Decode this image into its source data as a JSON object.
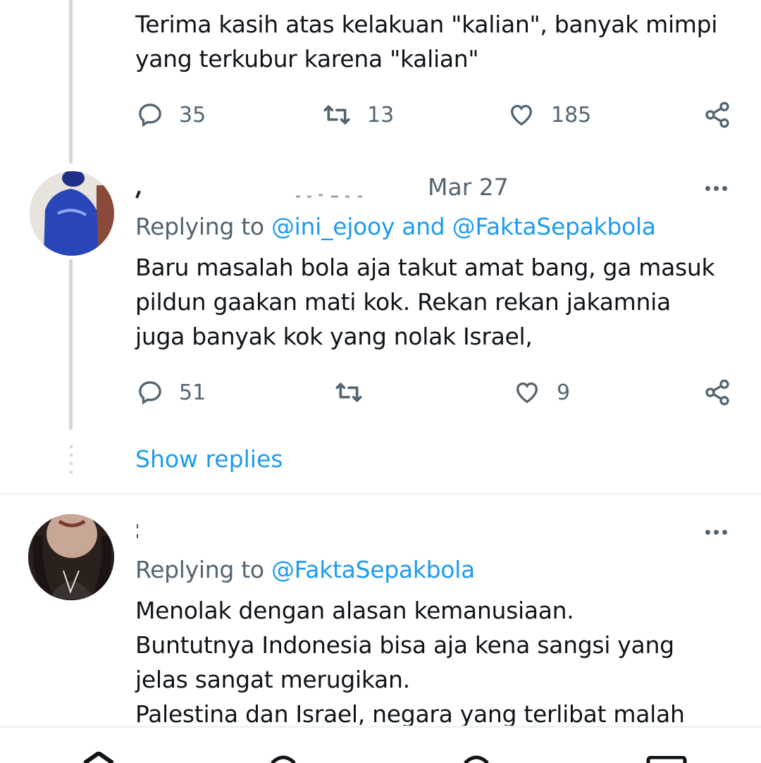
{
  "tweet_top": {
    "text_lines": [
      "Terima kasih atas kelakuan \"kalian\", banyak mimpi",
      "yang terkubur karena \"kalian\""
    ],
    "reply_count": "35",
    "retweet_count": "13",
    "like_count": "185"
  },
  "tweet_reply1": {
    "date": "Mar 27",
    "replying_prefix": "Replying to ",
    "mention1": "@ini_ejooy",
    "and": " and ",
    "mention2": "@FaktaSepakbola",
    "text_lines": [
      "Baru masalah bola aja takut amat bang, ga masuk",
      "pildun gaakan mati kok. Rekan rekan jakamnia",
      "juga banyak kok yang nolak Israel,"
    ],
    "reply_count": "51",
    "retweet_count": "",
    "like_count": "9"
  },
  "show_replies": "Show replies",
  "tweet_reply2": {
    "replying_prefix": "Replying to ",
    "mention": "@FaktaSepakbola",
    "text_lines": [
      "Menolak dengan alasan kemanusiaan.",
      "Buntutnya Indonesia bisa aja kena sangsi yang",
      "jelas sangat merugikan.",
      "Palestina dan Israel, negara yang terlibat malah"
    ]
  },
  "colors": {
    "link": "#1d9bf0",
    "secondary_text": "#536471",
    "primary_text": "#0f1419",
    "thread_line": "#cfd9de"
  },
  "icons": [
    "reply-icon",
    "retweet-icon",
    "like-icon",
    "share-icon",
    "more-icon",
    "home-icon",
    "search-icon",
    "notifications-icon",
    "messages-icon"
  ]
}
